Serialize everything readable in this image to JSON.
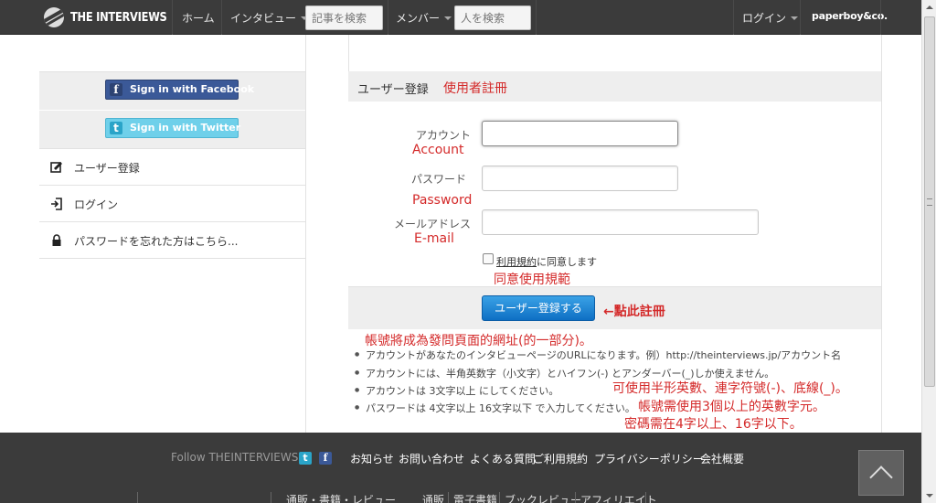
{
  "nav": {
    "logo_text": "THE INTERVIEWS",
    "home": "ホーム",
    "interviews": "インタビュー",
    "article_search_placeholder": "記事を検索",
    "members": "メンバー",
    "people_search_placeholder": "人を検索",
    "login": "ログイン",
    "brand": "paperboy&co."
  },
  "sidebar": {
    "facebook_label": "Sign in with Facebook",
    "twitter_label": "Sign in with Twitter",
    "items": [
      {
        "label": "ユーザー登録",
        "icon": "register-icon"
      },
      {
        "label": "ログイン",
        "icon": "login-icon"
      },
      {
        "label": "パスワードを忘れた方はこちら...",
        "icon": "lock-icon"
      }
    ]
  },
  "form": {
    "title": "ユーザー登録",
    "title_note": "使用者註冊",
    "account_label": "アカウント",
    "account_note": "Account",
    "password_label": "パスワード",
    "password_note": "Password",
    "email_label": "メールアドレス",
    "email_note": "E-mail",
    "account_value": "",
    "password_value": "",
    "email_value": "",
    "agree_link": "利用規約",
    "agree_text": "に同意します",
    "agree_note": "同意使用規範",
    "submit_label": "ユーザー登録する",
    "submit_note": "←點此註冊"
  },
  "notes": {
    "url_note": "帳號將成為發問頁面的網址(的一部分)。",
    "bullets": [
      "アカウントがあなたのインタビューページのURLになります。例）http://theinterviews.jp/アカウント名",
      "アカウントには、半角英数字（小文字）とハイフン(-) とアンダーバー(_)しか使えません。",
      "アカウントは 3文字以上 にしてください。",
      "パスワードは 4文字以上 16文字以下 で入力してください。"
    ],
    "charset_note": "可使用半形英數、連字符號(-)、底線(_)。",
    "account_len_note": "帳號需使用3個以上的英數字元。",
    "password_len_note": "密碼需在4字以上、16字以下。"
  },
  "footer": {
    "follow": "Follow THEINTERVIEWS",
    "links": [
      "お知らせ",
      "お問い合わせ",
      "よくある質問",
      "ご利用規約",
      "プライバシーポリシー",
      "会社概要"
    ],
    "sub_links": [
      "通販・書籍・レビュー",
      "通販",
      "電子書籍",
      "ブックレビュー",
      "アフィリエイト"
    ]
  }
}
